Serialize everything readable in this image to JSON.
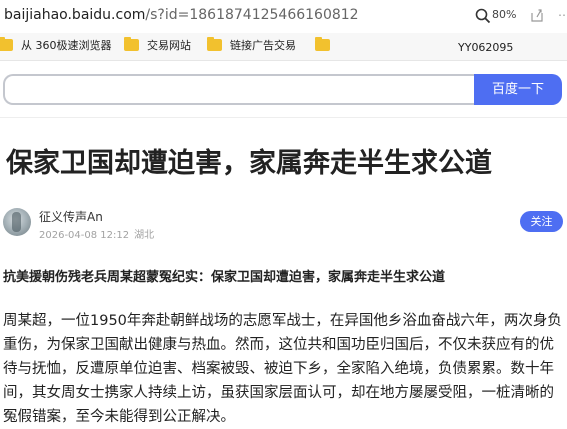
{
  "browser": {
    "url_host": "baijiahao.baidu.com",
    "url_path": "/s?id=1861874125466160812",
    "zoom": "80%",
    "zoom_icon": "magnifier-icon",
    "share_icon": "share-icon",
    "more_icon": "more-icon"
  },
  "bookmarks": {
    "items": [
      {
        "label": "从 360极速浏览器",
        "icon": "folder-icon"
      },
      {
        "label": "交易网站",
        "icon": "folder-icon"
      },
      {
        "label": "链接广告交易",
        "icon": "folder-icon"
      },
      {
        "label": "",
        "icon": "folder-icon"
      }
    ],
    "code": "YY062095"
  },
  "search": {
    "value": "",
    "button_label": "百度一下",
    "button_color": "#4e6ef2"
  },
  "article": {
    "title": "保家卫国却遭迫害，家属奔走半生求公道",
    "author": "征义传声An",
    "date": "2026-04-08 12:12",
    "location": "湖北",
    "follow_label": "关注",
    "subtitle": "抗美援朝伤残老兵周某超蒙冤纪实：保家卫国却遭迫害，家属奔走半生求公道",
    "body": "周某超，一位1950年奔赴朝鲜战场的志愿军战士，在异国他乡浴血奋战六年，两次身负重伤，为保家卫国献出健康与热血。然而，这位共和国功臣归国后，不仅未获应有的优待与抚恤，反遭原单位迫害、档案被毁、被迫下乡，全家陷入绝境，负债累累。数十年间，其女周女士携家人持续上访，虽获国家层面认可，却在地方屡屡受阻，一桩清晰的冤假错案，至今未能得到公正解决。"
  }
}
